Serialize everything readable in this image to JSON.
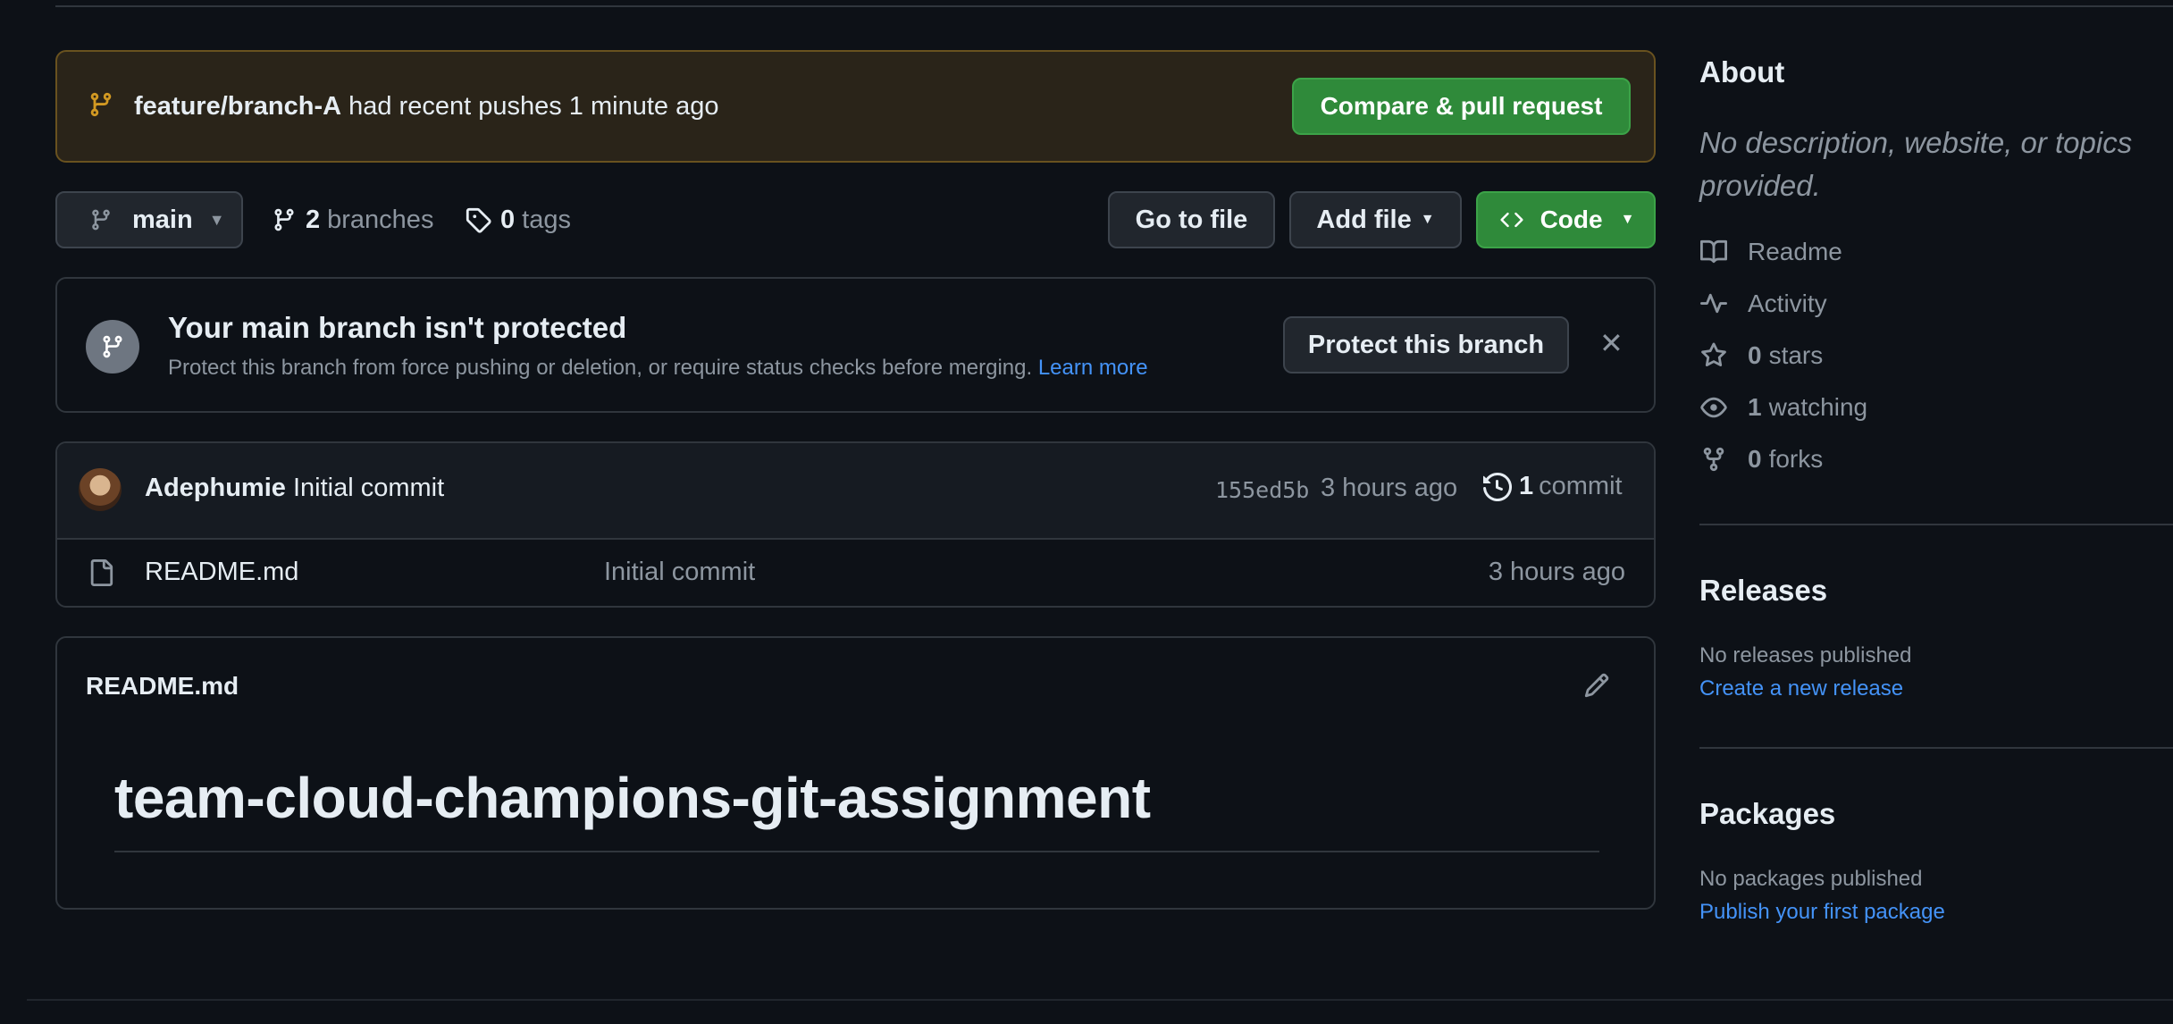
{
  "push_banner": {
    "branch": "feature/branch-A",
    "message": "had recent pushes 1 minute ago",
    "button": "Compare & pull request"
  },
  "branch_bar": {
    "current_branch": "main",
    "branches_count": "2",
    "branches_label": "branches",
    "tags_count": "0",
    "tags_label": "tags",
    "go_to_file": "Go to file",
    "add_file": "Add file",
    "code": "Code"
  },
  "protect": {
    "title": "Your main branch isn't protected",
    "description": "Protect this branch from force pushing or deletion, or require status checks before merging.",
    "learn_more": "Learn more",
    "button": "Protect this branch"
  },
  "latest_commit": {
    "author": "Adephumie",
    "message": "Initial commit",
    "sha": "155ed5b",
    "time": "3 hours ago",
    "commit_count": "1",
    "commit_label": "commit"
  },
  "files": [
    {
      "name": "README.md",
      "message": "Initial commit",
      "time": "3 hours ago"
    }
  ],
  "readme": {
    "filename": "README.md",
    "heading": "team-cloud-champions-git-assignment"
  },
  "about": {
    "title": "About",
    "description": "No description, website, or topics provided.",
    "readme": "Readme",
    "activity": "Activity",
    "stars_count": "0",
    "stars_label": "stars",
    "watching_count": "1",
    "watching_label": "watching",
    "forks_count": "0",
    "forks_label": "forks"
  },
  "releases": {
    "title": "Releases",
    "empty": "No releases published",
    "link": "Create a new release"
  },
  "packages": {
    "title": "Packages",
    "empty": "No packages published",
    "link": "Publish your first package"
  },
  "colors": {
    "background": "#0d1117",
    "accent_green": "#2f8a3a",
    "link_blue": "#4493f8",
    "banner_border": "#69521f"
  }
}
